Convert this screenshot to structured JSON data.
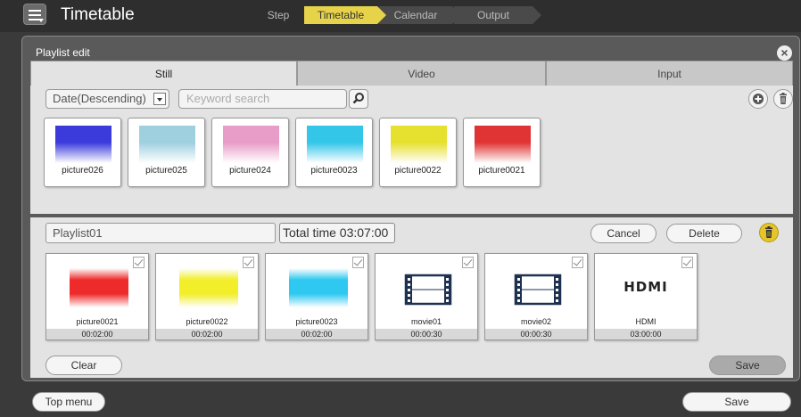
{
  "header": {
    "title": "Timetable",
    "steps": [
      {
        "label": "Step",
        "state": "label"
      },
      {
        "label": "Timetable",
        "state": "active"
      },
      {
        "label": "Calendar",
        "state": "inactive"
      },
      {
        "label": "Output",
        "state": "inactive"
      }
    ]
  },
  "dialog": {
    "title": "Playlist edit",
    "tabs": [
      {
        "label": "Still",
        "active": true
      },
      {
        "label": "Video",
        "active": false
      },
      {
        "label": "Input",
        "active": false
      }
    ]
  },
  "library": {
    "sort_value": "Date(Descending)",
    "search_placeholder": "Keyword search",
    "items": [
      {
        "name": "picture026",
        "color": "#3b3bdc"
      },
      {
        "name": "picture025",
        "color": "#9fd0e0"
      },
      {
        "name": "picture024",
        "color": "#e89cc8"
      },
      {
        "name": "picture0023",
        "color": "#34c6e8"
      },
      {
        "name": "picture0022",
        "color": "#e6e02e"
      },
      {
        "name": "picture0021",
        "color": "#e03434"
      }
    ]
  },
  "playlist": {
    "name": "Playlist01",
    "total_time": "Total time 03:07:00",
    "cancel_label": "Cancel",
    "delete_label": "Delete",
    "clear_label": "Clear",
    "save_label": "Save",
    "items": [
      {
        "name": "picture0021",
        "time": "00:02:00",
        "kind": "image",
        "color": "#ee2a2a"
      },
      {
        "name": "picture0022",
        "time": "00:02:00",
        "kind": "image",
        "color": "#f2ee2a"
      },
      {
        "name": "picture0023",
        "time": "00:02:00",
        "kind": "image",
        "color": "#2ec8f0"
      },
      {
        "name": "movie01",
        "time": "00:00:30",
        "kind": "movie"
      },
      {
        "name": "movie02",
        "time": "00:00:30",
        "kind": "movie"
      },
      {
        "name": "HDMI",
        "time": "03:00:00",
        "kind": "hdmi",
        "logo": "HDMI"
      }
    ]
  },
  "footer": {
    "top_menu_label": "Top menu",
    "save_label": "Save"
  }
}
